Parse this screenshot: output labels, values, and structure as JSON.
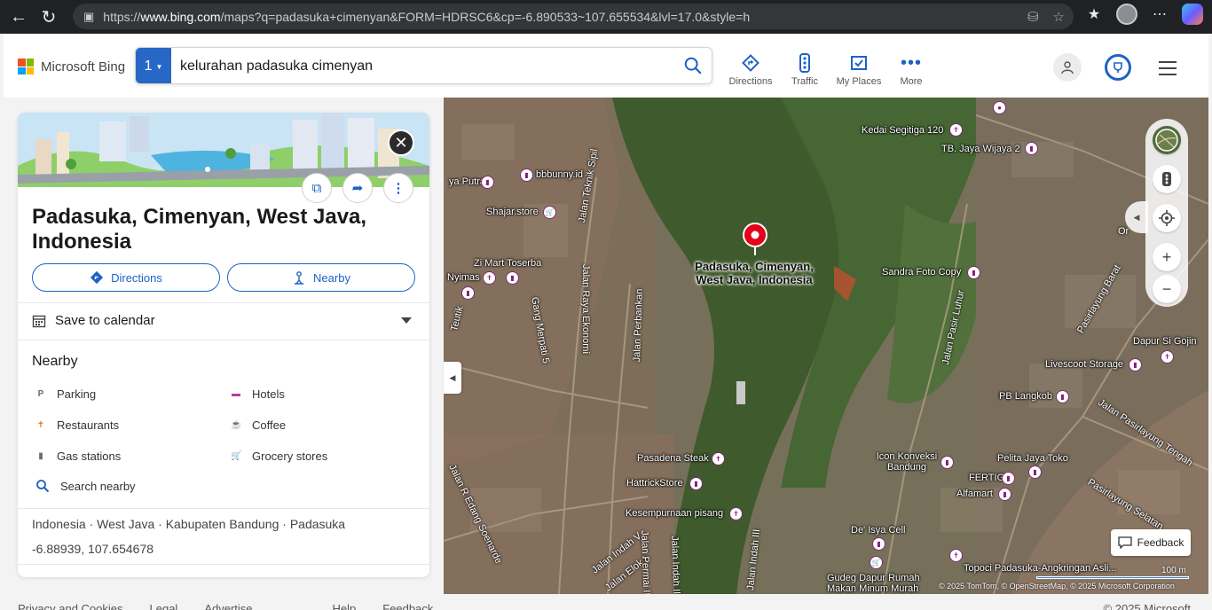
{
  "browser": {
    "url_prefix": "https://",
    "url_host": "www.bing.com",
    "url_rest": "/maps?q=padasuka+cimenyan&FORM=HDRSC6&cp=-6.890533~107.655534&lvl=17.0&style=h"
  },
  "header": {
    "logo_text": "Microsoft Bing",
    "search_index": "1",
    "search_query": "kelurahan padasuka cimenyan",
    "tools": [
      {
        "label": "Directions",
        "icon": "directions-icon"
      },
      {
        "label": "Traffic",
        "icon": "traffic-icon"
      },
      {
        "label": "My Places",
        "icon": "my-places-icon"
      },
      {
        "label": "More",
        "icon": "more-icon"
      }
    ]
  },
  "panel": {
    "title": "Padasuka, Cimenyan, West Java, Indonesia",
    "directions_label": "Directions",
    "nearby_button_label": "Nearby",
    "calendar_label": "Save to calendar",
    "nearby_heading": "Nearby",
    "nearby_items": [
      {
        "label": "Parking",
        "icon": "parking-icon",
        "color": "#6b6b6b"
      },
      {
        "label": "Hotels",
        "icon": "hotel-icon",
        "color": "#b53e9c"
      },
      {
        "label": "Restaurants",
        "icon": "restaurant-icon",
        "color": "#e07a2c"
      },
      {
        "label": "Coffee",
        "icon": "coffee-icon",
        "color": "#e07a2c"
      },
      {
        "label": "Gas stations",
        "icon": "gas-station-icon",
        "color": "#6b6b6b"
      },
      {
        "label": "Grocery stores",
        "icon": "grocery-icon",
        "color": "#4a4ad0"
      }
    ],
    "search_nearby_label": "Search nearby",
    "address": "Indonesia · West Java · Kabupaten Bandung · Padasuka",
    "coordinates": "-6.88939, 107.654678"
  },
  "footer": {
    "links": [
      "Privacy and Cookies",
      "Legal",
      "Advertise",
      "Help",
      "Feedback"
    ],
    "copyright": "© 2025 Microsoft"
  },
  "map": {
    "pin_label": "Padasuka, Cimenyan, West Java, Indonesia",
    "places": [
      {
        "name": "Kedai Segitiga 120",
        "type": "restaurant"
      },
      {
        "name": "TB. Jaya Wijaya 2",
        "type": "shop"
      },
      {
        "name": "bbbunny.id",
        "type": "shop"
      },
      {
        "name": "ya Putra",
        "type": "shop"
      },
      {
        "name": "Shajar.store",
        "type": "grocery"
      },
      {
        "name": "Zi Mart Toserba",
        "type": "shop"
      },
      {
        "name": "Nyimas",
        "type": "restaurant"
      },
      {
        "name": "Sandra Foto Copy",
        "type": "shop"
      },
      {
        "name": "Dapur Si Gojin",
        "type": "restaurant"
      },
      {
        "name": "Livescoot Storage",
        "type": "shop"
      },
      {
        "name": "PB Langkob",
        "type": "shop"
      },
      {
        "name": "Pasadena Steak",
        "type": "restaurant"
      },
      {
        "name": "HattrickStore",
        "type": "shop"
      },
      {
        "name": "Icon Konveksi Bandung",
        "type": "shop"
      },
      {
        "name": "Pelita Jaya Toko",
        "type": "shop"
      },
      {
        "name": "FERTIG",
        "type": "shop"
      },
      {
        "name": "Alfamart",
        "type": "shop"
      },
      {
        "name": "Kesempurnaan pisang",
        "type": "restaurant"
      },
      {
        "name": "De' Isya Cell",
        "type": "shop"
      },
      {
        "name": "Gudeg Dapur Rumah Makan Minum Murah",
        "type": "grocery"
      },
      {
        "name": "Topoci Padasuka-Angkringan Asli...",
        "type": "restaurant"
      }
    ],
    "roads": [
      "Jalan Teknik Sipil",
      "Jalan Raya Ekonomi",
      "Jalan Perbankan",
      "Gang Merpati 5",
      "Jalan Pasir Luhur",
      "Pasirlayung Barat",
      "Jalan Pasirlayung Tengah",
      "Pasirlayung Selatan",
      "Jalan R Edang Soenarde",
      "Jalan Indah V",
      "Jalan Elok I",
      "Jalan Permai II",
      "Jalan Indah III",
      "Jalan Indah II",
      "Jalan Ra",
      "Teutik"
    ],
    "feedback_label": "Feedback",
    "scale_label": "100 m",
    "attribution": "© 2025 TomTom, © OpenStreetMap, © 2025 Microsoft Corporation",
    "partial_label": "Or"
  }
}
